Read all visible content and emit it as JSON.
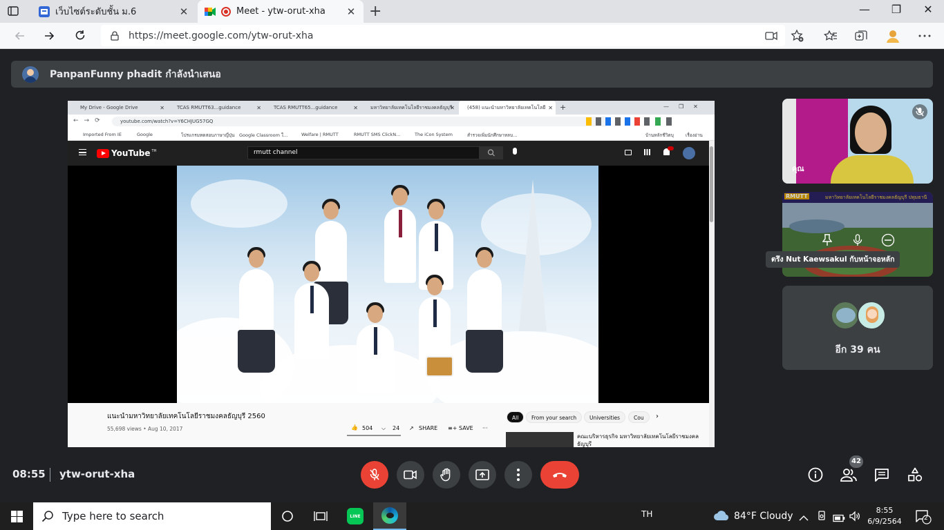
{
  "browser": {
    "tabs": [
      {
        "title": "เว็บไซต์ระดับชั้น ม.6",
        "active": false
      },
      {
        "title": "Meet - ytw-orut-xha",
        "active": true
      }
    ],
    "url": "https://meet.google.com/ytw-orut-xha"
  },
  "meet": {
    "presenter_text": "PanpanFunny phadit กำลังนำเสนอ",
    "time": "08:55",
    "meeting_code": "ytw-orut-xha",
    "participant_count": "42",
    "self_label": "คุณ",
    "pinned_tooltip": "ตรึง Nut Kaewsakul กับหน้าจอหลัก",
    "more_people": "อีก 39 คน",
    "colors": {
      "red": "#ea4335",
      "tile": "#3c4043",
      "bg": "#202124"
    }
  },
  "shared_screen": {
    "tabs": [
      "My Drive - Google Drive",
      "TCAS RMUTT63...guidance",
      "TCAS RMUTT65...guidance",
      "มหาวิทยาลัยเทคโนโลยีราชมงคลธัญบุรี",
      "(458) แนะนำมหาวิทยาลัยเทคโนโลยี"
    ],
    "url": "youtube.com/watch?v=Y6CHJUG57GQ",
    "bookmarks": [
      "Imported From IE",
      "Google",
      "โปรแกรมทดสอบภาษาญี่ปุ่น",
      "Google Classroom ใ...",
      "Welfare | RMUTT",
      "RMUTT SMS ClickN...",
      "The iCon System",
      "สำรวจเพิ่มนักศึกษาหลบ...",
      "บ้านหลักชีวิตบุ",
      "เรื่องอ่าน"
    ],
    "youtube": {
      "logo": "YouTube",
      "region": "TH",
      "search": "rmutt channel",
      "video_title": "แนะนำมหาวิทยาลัยเทคโนโลยีราชมงคลธัญบุรี 2560",
      "meta": "55,698 views • Aug 10, 2017",
      "likes": "504",
      "dislikes": "24",
      "share": "SHARE",
      "save": "SAVE",
      "chips": [
        "All",
        "From your search",
        "Universities",
        "Cou"
      ],
      "next_title": "คณะบริหารธุรกิจ มหาวิทยาลัยเทคโนโลยีราชมงคลธัญบุรี"
    },
    "tile2_header": "RMUTT",
    "tile2_banner": "มหาวิทยาลัยเทคโนโลยีราชมงคลธัญบุรี ปทุมธานี"
  },
  "taskbar": {
    "search_placeholder": "Type here to search",
    "line_label": "LINE",
    "lang": "TH",
    "weather": "84°F  Cloudy",
    "clock_time": "8:55",
    "clock_date": "6/9/2564",
    "notifications": "2"
  }
}
